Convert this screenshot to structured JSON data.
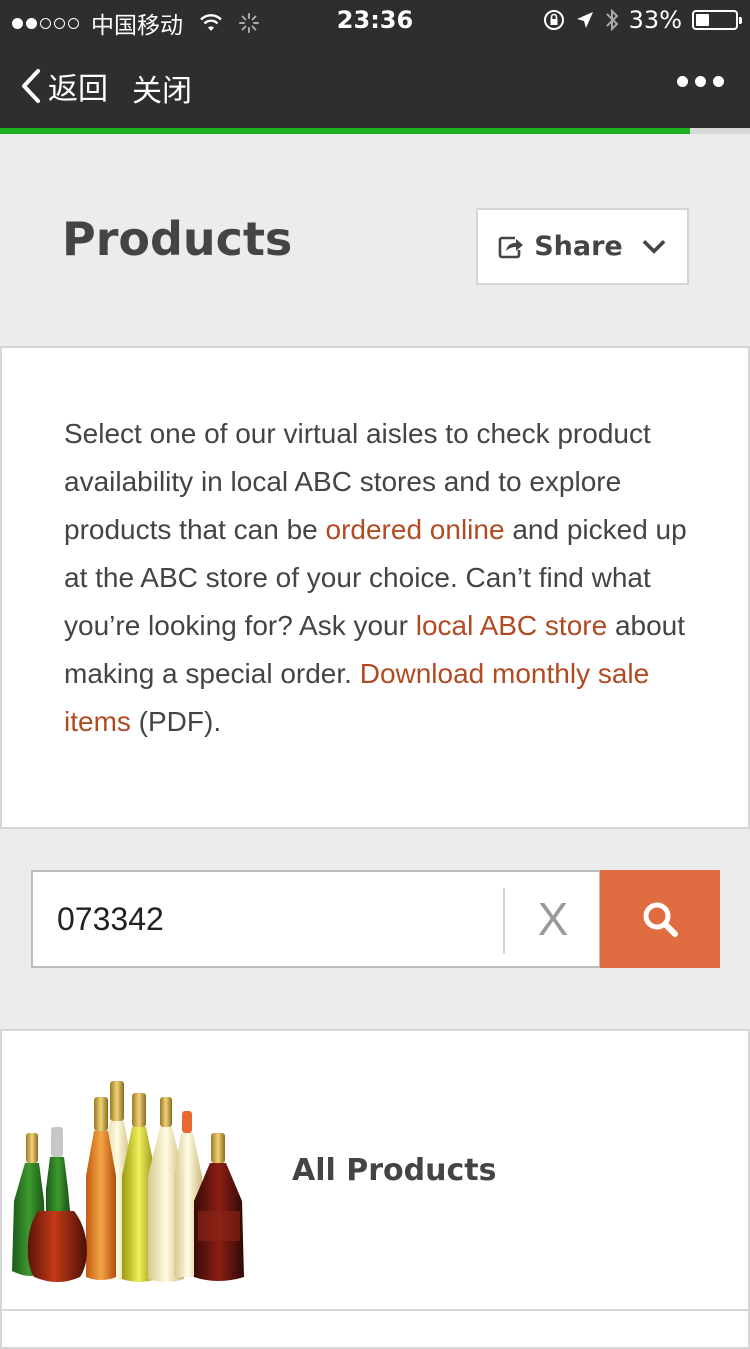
{
  "status_bar": {
    "carrier": "中国移动",
    "time": "23:36",
    "battery": "33%",
    "battery_level": 0.33
  },
  "nav": {
    "back_label": "返回",
    "close_label": "关闭",
    "page_progress": 0.92
  },
  "header": {
    "title": "Products",
    "share_label": "Share"
  },
  "intro": {
    "part1": "Select one of our virtual aisles to check product availability in local ABC stores and to explore products that can be ",
    "link_ordered_online": "ordered online",
    "part2": " and picked up at the ABC store of your choice. Can’t find what you’re looking for? Ask your ",
    "link_local_store": "local ABC store",
    "part3": " about making a special order. ",
    "link_download": "Download monthly sale items",
    "part4": " (PDF)."
  },
  "search": {
    "value": "073342",
    "clear_label": "X"
  },
  "categories": [
    {
      "label": "All Products"
    }
  ],
  "colors": {
    "accent": "#e06c42",
    "link": "#b24a22",
    "progress": "#1ab221",
    "nav_bg": "#2e2e30"
  }
}
